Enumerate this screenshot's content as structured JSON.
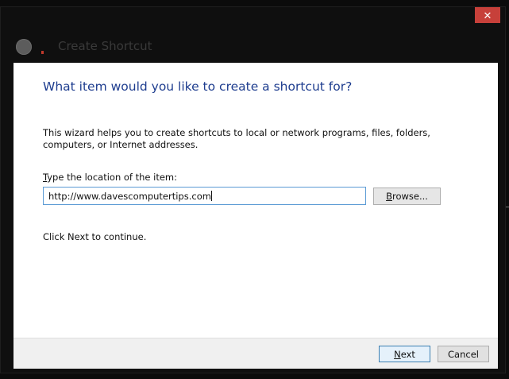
{
  "window": {
    "title": "Create Shortcut",
    "close_glyph": "✕"
  },
  "wizard": {
    "heading": "What item would you like to create a shortcut for?",
    "description": "This wizard helps you to create shortcuts to local or network programs, files, folders, computers, or Internet addresses.",
    "location_label_prefix": "T",
    "location_label_rest": "ype the location of the item:",
    "location_value": "http://www.davescomputertips.com",
    "browse_prefix": "B",
    "browse_rest": "rowse...",
    "continue_text": "Click Next to continue."
  },
  "footer": {
    "next_prefix": "N",
    "next_rest": "ext",
    "cancel_label": "Cancel"
  },
  "colors": {
    "heading": "#1e3d8f",
    "close_button": "#c7403a",
    "input_focus_border": "#5b9bd5",
    "next_button_border": "#3c7fb1"
  },
  "icons": [
    "back-arrow-icon",
    "shortcut-app-icon",
    "close-icon"
  ]
}
